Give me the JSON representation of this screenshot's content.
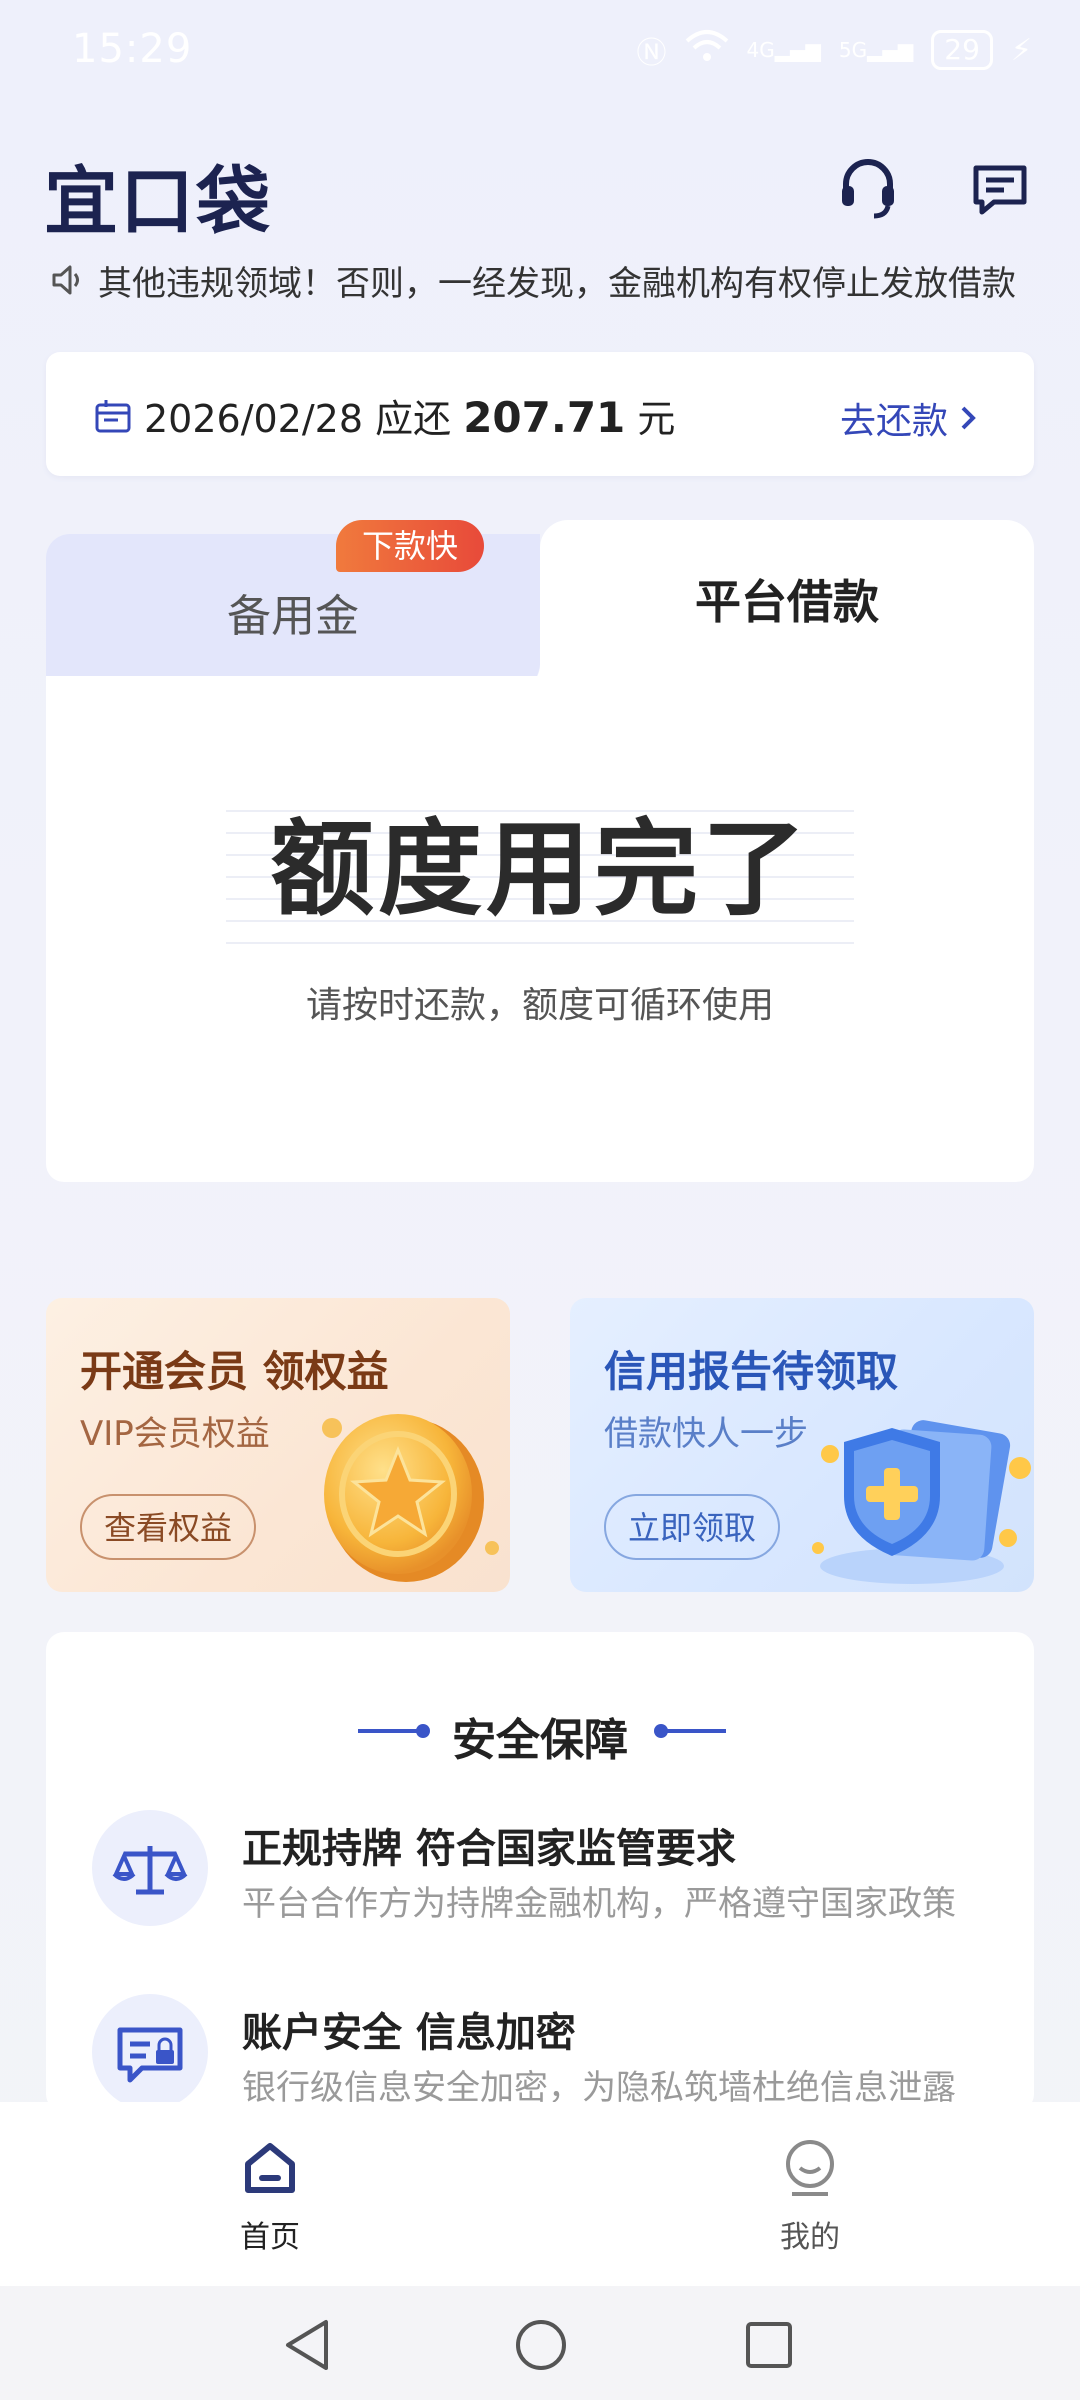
{
  "status": {
    "time": "15:29",
    "battery": "29",
    "net1": "4G",
    "net2": "5G"
  },
  "app": {
    "logo": "宜口袋"
  },
  "notice": {
    "text": "其他违规领域！否则，一经发现，金融机构有权停止发放借款"
  },
  "repayment": {
    "date_prefix": "2026/02/28 应还 ",
    "amount": "207.71",
    "unit": " 元",
    "action": "去还款"
  },
  "tabs": {
    "left": "备用金",
    "left_badge": "下款快",
    "right": "平台借款"
  },
  "quota": {
    "headline": "额度用完了",
    "subtitle": "请按时还款，额度可循环使用"
  },
  "promos": {
    "vip": {
      "title": "开通会员 领权益",
      "subtitle": "VIP会员权益",
      "button": "查看权益"
    },
    "credit": {
      "title": "信用报告待领取",
      "subtitle": "借款快人一步",
      "button": "立即领取"
    }
  },
  "security": {
    "title": "安全保障",
    "items": [
      {
        "heading": "正规持牌 符合国家监管要求",
        "desc": "平台合作方为持牌金融机构，严格遵守国家政策"
      },
      {
        "heading": "账户安全 信息加密",
        "desc": "银行级信息安全加密，为隐私筑墙杜绝信息泄露"
      }
    ]
  },
  "bottom_nav": [
    {
      "label": "首页",
      "active": true
    },
    {
      "label": "我的",
      "active": false
    }
  ],
  "colors": {
    "brand": "#1c2350",
    "accent": "#3447b8",
    "badge": "#e84a3a"
  }
}
